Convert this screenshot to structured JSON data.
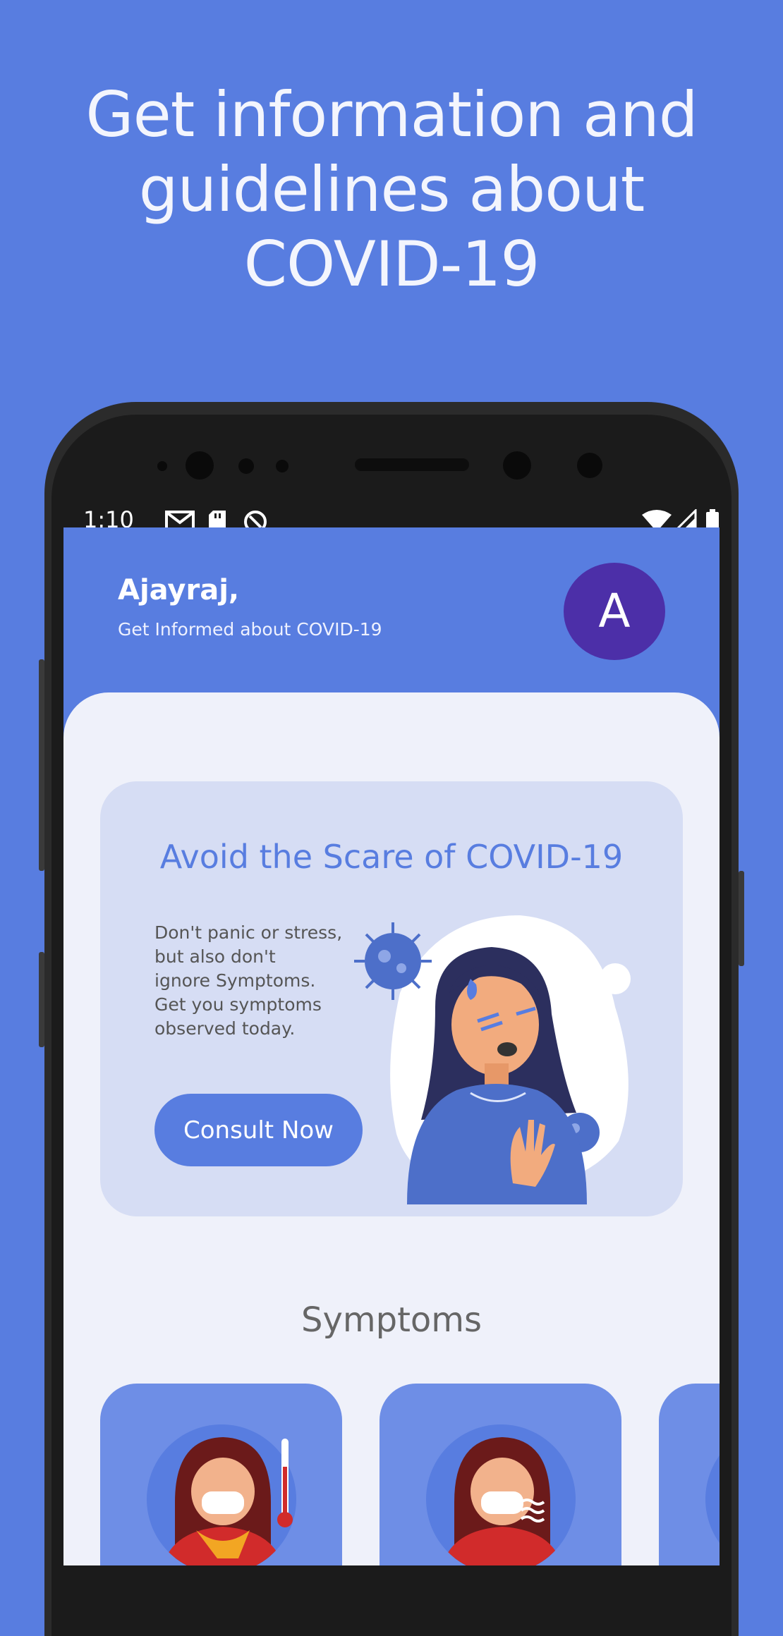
{
  "headline": {
    "line1": "Get information and",
    "line2": "guidelines about",
    "line3": "COVID-19"
  },
  "statusbar": {
    "time": "1:10",
    "icons": [
      "gmail-icon",
      "sd-card-icon",
      "sync-icon",
      "wifi-icon",
      "signal-icon",
      "battery-icon"
    ]
  },
  "header": {
    "name": "Ajayraj,",
    "subtitle": "Get Informed about COVID-19",
    "avatar_letter": "A"
  },
  "promo": {
    "title": "Avoid the Scare of COVID-19",
    "text": "Don't panic or stress,\nbut also don't\n ignore Symptoms.\nGet you symptoms\nobserved today.",
    "button_label": "Consult Now"
  },
  "symptoms": {
    "title": "Symptoms",
    "cards": [
      {
        "icon": "fever-symptom-icon"
      },
      {
        "icon": "cough-symptom-icon"
      },
      {
        "icon": "symptom-icon"
      }
    ]
  },
  "colors": {
    "background": "#587de0",
    "avatar": "#4c2fa8",
    "panel": "#eff1fa",
    "promo_card": "#d6ddf4",
    "symptom_card": "#6e8ee6"
  }
}
